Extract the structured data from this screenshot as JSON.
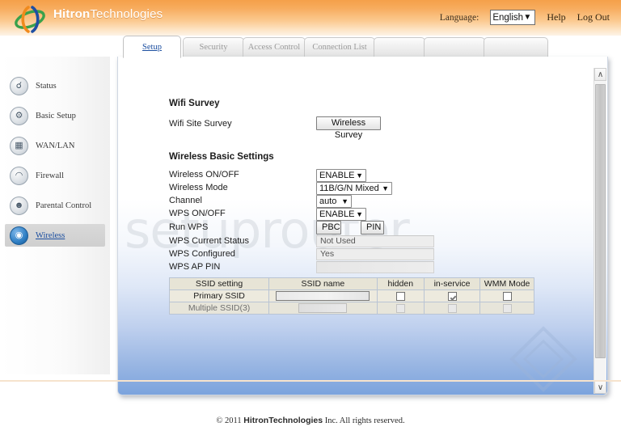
{
  "header": {
    "brand_bold": "Hitron",
    "brand_light": "Technologies",
    "language_label": "Language:",
    "language_value": "English",
    "language_options": [
      "English"
    ],
    "help_label": "Help",
    "logout_label": "Log Out"
  },
  "tabs": [
    {
      "label": "Setup",
      "active": true
    },
    {
      "label": "Security",
      "active": false
    },
    {
      "label": "Access Control",
      "active": false
    },
    {
      "label": "Connection List",
      "active": false
    },
    {
      "label": "",
      "active": false
    },
    {
      "label": "",
      "active": false
    },
    {
      "label": "",
      "active": false
    }
  ],
  "sidebar": {
    "items": [
      {
        "label": "Status",
        "icon": "wrench-icon",
        "glyph": "⚒",
        "active": false
      },
      {
        "label": "Basic Setup",
        "icon": "gears-icon",
        "glyph": "⚙",
        "active": false
      },
      {
        "label": "WAN/LAN",
        "icon": "network-icon",
        "glyph": "⛭",
        "active": false
      },
      {
        "label": "Firewall",
        "icon": "firewall-icon",
        "glyph": "☗",
        "active": false
      },
      {
        "label": "Parental Control",
        "icon": "user-icon",
        "glyph": "♟",
        "active": false
      },
      {
        "label": "Wireless",
        "icon": "wifi-icon",
        "glyph": "(•)",
        "active": true
      }
    ]
  },
  "main": {
    "watermark": "setuprouter",
    "wifi_survey": {
      "title": "Wifi Survey",
      "row_label": "Wifi Site Survey",
      "button_label": "Wireless Survey"
    },
    "wireless_basic": {
      "title": "Wireless Basic Settings",
      "rows": [
        {
          "label": "Wireless ON/OFF",
          "type": "select",
          "value": "ENABLE"
        },
        {
          "label": "Wireless Mode",
          "type": "select",
          "value": "11B/G/N Mixed"
        },
        {
          "label": "Channel",
          "type": "select",
          "value": "auto"
        },
        {
          "label": "WPS ON/OFF",
          "type": "select",
          "value": "ENABLE"
        },
        {
          "label": "Run WPS",
          "type": "buttons",
          "buttons": [
            "PBC",
            "PIN"
          ]
        },
        {
          "label": "WPS Current Status",
          "type": "readonly",
          "value": "Not Used"
        },
        {
          "label": "WPS Configured",
          "type": "readonly",
          "value": "Yes"
        },
        {
          "label": "WPS AP PIN",
          "type": "readonly",
          "value": ""
        }
      ]
    },
    "ssid_table": {
      "headers": [
        "SSID setting",
        "SSID name",
        "hidden",
        "in-service",
        "WMM Mode"
      ],
      "rows": [
        {
          "setting": "Primary SSID",
          "name_value": "",
          "name_disabled": false,
          "hidden_checked": false,
          "hidden_disabled": false,
          "in_service_checked": true,
          "in_service_disabled": false,
          "wmm_checked": false,
          "wmm_disabled": false,
          "disabled": false
        },
        {
          "setting": "Multiple SSID(3)",
          "name_value": "",
          "name_disabled": true,
          "hidden_checked": false,
          "hidden_disabled": true,
          "in_service_checked": false,
          "in_service_disabled": true,
          "wmm_checked": false,
          "wmm_disabled": true,
          "disabled": true
        }
      ]
    }
  },
  "scrollbar": {
    "up_glyph": "∧",
    "down_glyph": "∨"
  },
  "footer": {
    "copyright_prefix": "© 2011",
    "company_bold": "Hitron",
    "company_light": "Technologies",
    "suffix": "Inc.  All rights reserved."
  },
  "colors": {
    "header_orange": "#f5a04a",
    "link_blue": "#1c4fa0",
    "panel_blue": "#7ba3dd",
    "table_beige": "#edeade"
  }
}
